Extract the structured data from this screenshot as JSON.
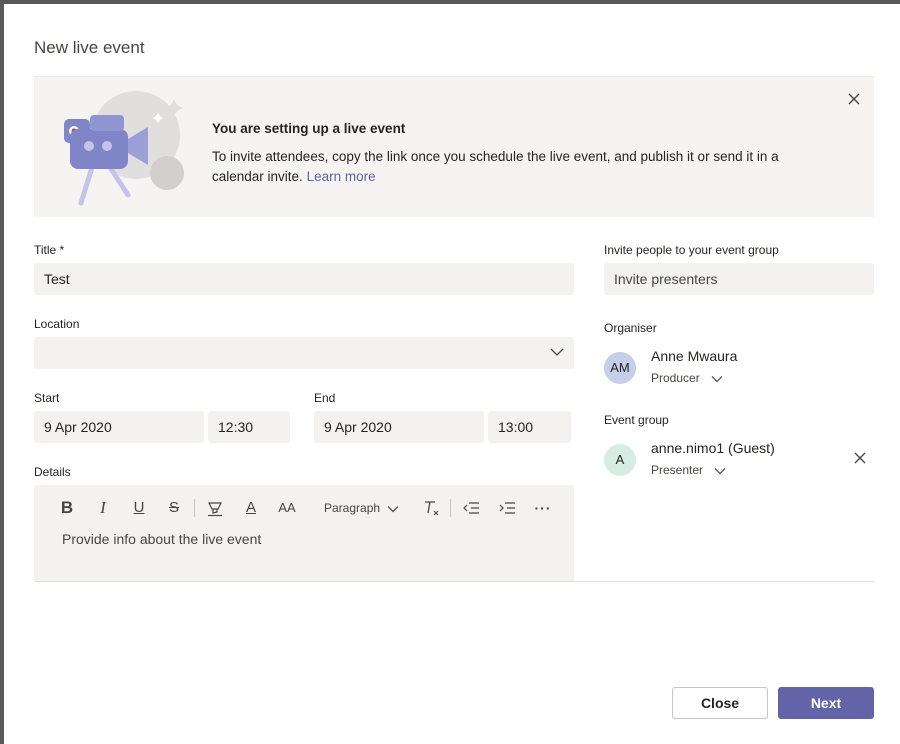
{
  "dialog": {
    "title": "New live event"
  },
  "banner": {
    "heading": "You are setting up a live event",
    "text": "To invite attendees, copy the link once you schedule the live event, and publish it or send it in a calendar invite.",
    "link": "Learn more"
  },
  "form": {
    "title_label": "Title *",
    "title_value": "Test",
    "location_label": "Location",
    "location_value": "",
    "start_label": "Start",
    "start_date": "9 Apr 2020",
    "start_time": "12:30",
    "end_label": "End",
    "end_date": "9 Apr 2020",
    "end_time": "13:00",
    "details_label": "Details",
    "details_placeholder": "Provide info about the live event"
  },
  "toolbar": {
    "bold": "B",
    "italic": "I",
    "underline": "U",
    "strike": "S",
    "font_color": "A",
    "font_size": "AA",
    "paragraph": "Paragraph",
    "more": "···"
  },
  "side": {
    "invite_label": "Invite people to your event group",
    "invite_placeholder": "Invite presenters",
    "organiser_label": "Organiser",
    "organiser": {
      "initials": "AM",
      "name": "Anne Mwaura",
      "role": "Producer"
    },
    "event_group_label": "Event group",
    "member": {
      "initials": "A",
      "name": "anne.nimo1 (Guest)",
      "role": "Presenter"
    }
  },
  "buttons": {
    "close": "Close",
    "next": "Next"
  },
  "colors": {
    "accent": "#6264a7",
    "field_bg": "#f3f2f1",
    "banner_bg": "#f5f4f3"
  },
  "icons": [
    "close-icon",
    "chevron-down-icon",
    "bold-icon",
    "italic-icon",
    "underline-icon",
    "strikethrough-icon",
    "highlight-icon",
    "font-color-icon",
    "font-size-icon",
    "clear-format-icon",
    "decrease-indent-icon",
    "increase-indent-icon",
    "more-options-icon"
  ]
}
